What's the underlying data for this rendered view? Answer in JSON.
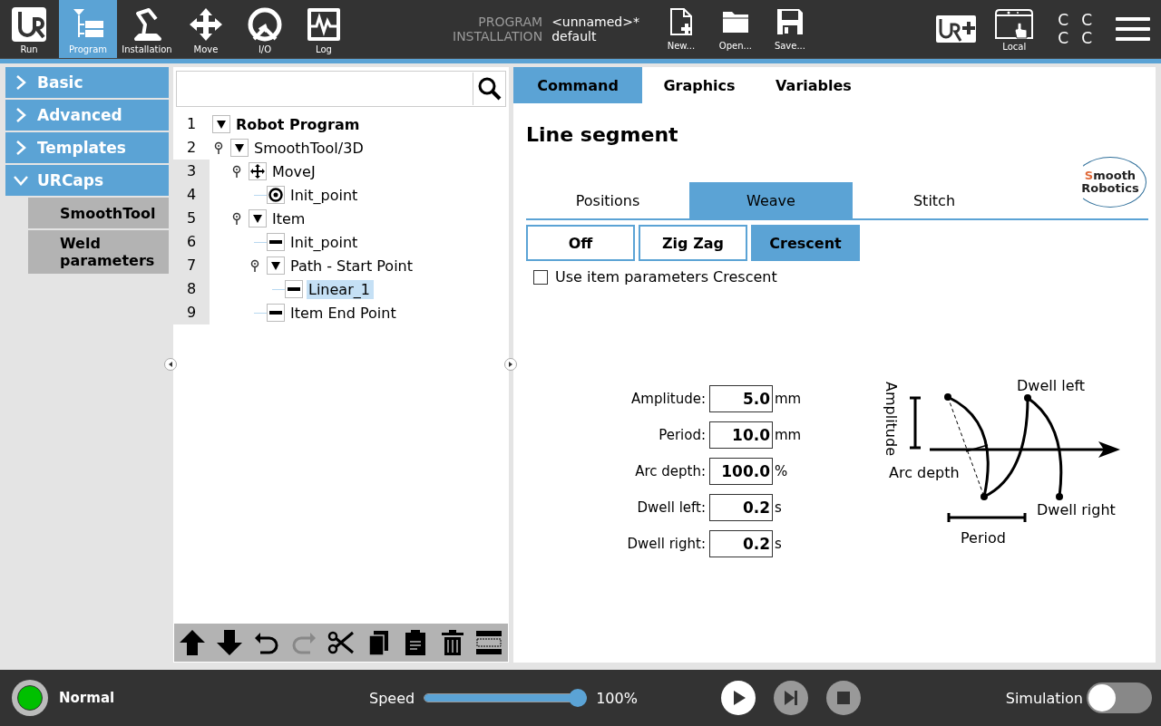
{
  "header": {
    "nav": [
      {
        "label": "Run",
        "selected": false
      },
      {
        "label": "Program",
        "selected": true
      },
      {
        "label": "Installation",
        "selected": false
      },
      {
        "label": "Move",
        "selected": false
      },
      {
        "label": "I/O",
        "selected": false
      },
      {
        "label": "Log",
        "selected": false
      }
    ],
    "program_info": [
      {
        "label": "PROGRAM",
        "value": "<unnamed>*"
      },
      {
        "label": "INSTALLATION",
        "value": "default"
      }
    ],
    "file_buttons": [
      "New...",
      "Open...",
      "Save..."
    ],
    "local_label": "Local",
    "corner_letters": [
      "C",
      "C",
      "C",
      "C"
    ]
  },
  "sidebar": [
    {
      "label": "Basic",
      "expanded": false
    },
    {
      "label": "Advanced",
      "expanded": false
    },
    {
      "label": "Templates",
      "expanded": false
    },
    {
      "label": "URCaps",
      "expanded": true,
      "children": [
        {
          "label": "SmoothTool"
        },
        {
          "label": "Weld parameters"
        }
      ]
    }
  ],
  "tree": {
    "nodes": [
      {
        "line": "1",
        "label": "Robot Program",
        "kind": "folder",
        "expanded": true,
        "selected": false,
        "shaded": false,
        "children": [
          {
            "line": "2",
            "label": "SmoothTool/3D",
            "kind": "folder",
            "expanded": true,
            "selected": false,
            "shaded": false,
            "children": [
              {
                "line": "3",
                "label": "MoveJ",
                "kind": "move",
                "selected": false,
                "shaded": true,
                "children": [
                  {
                    "line": "4",
                    "label": "Init_point",
                    "kind": "waypoint",
                    "selected": false,
                    "shaded": true
                  }
                ]
              },
              {
                "line": "5",
                "label": "Item",
                "kind": "folder",
                "expanded": true,
                "selected": false,
                "shaded": true,
                "children": [
                  {
                    "line": "6",
                    "label": "Init_point",
                    "kind": "line",
                    "selected": false,
                    "shaded": true
                  },
                  {
                    "line": "7",
                    "label": "Path - Start Point",
                    "kind": "folder",
                    "expanded": true,
                    "selected": false,
                    "shaded": true,
                    "children": [
                      {
                        "line": "8",
                        "label": "Linear_1",
                        "kind": "line",
                        "selected": true,
                        "shaded": true
                      }
                    ]
                  },
                  {
                    "line": "9",
                    "label": "Item End Point",
                    "kind": "line",
                    "selected": false,
                    "shaded": true
                  }
                ]
              }
            ]
          }
        ]
      }
    ],
    "toolbar": [
      {
        "disabled": false
      },
      {
        "disabled": false
      },
      {
        "disabled": false
      },
      {
        "disabled": true
      },
      {
        "disabled": false
      },
      {
        "disabled": false
      },
      {
        "disabled": false
      },
      {
        "disabled": false
      },
      {
        "disabled": false
      }
    ]
  },
  "panel": {
    "tabs": [
      {
        "label": "Command",
        "selected": true
      },
      {
        "label": "Graphics",
        "selected": false
      },
      {
        "label": "Variables",
        "selected": false
      }
    ],
    "title": "Line segment",
    "logo": {
      "accent": "S",
      "rest": "mooth",
      "line_2": "Robotics"
    },
    "subtabs": [
      {
        "label": "Positions",
        "selected": false
      },
      {
        "label": "Weave",
        "selected": true
      },
      {
        "label": "Stitch",
        "selected": false
      }
    ],
    "modes": [
      {
        "label": "Off",
        "selected": false
      },
      {
        "label": "Zig Zag",
        "selected": false
      },
      {
        "label": "Crescent",
        "selected": true
      }
    ],
    "checkbox": {
      "label": "Use item parameters Crescent",
      "checked": false
    },
    "params": [
      {
        "label": "Amplitude:",
        "value": "5.0",
        "unit": "mm"
      },
      {
        "label": "Period:",
        "value": "10.0",
        "unit": "mm"
      },
      {
        "label": "Arc depth:",
        "value": "100.0",
        "unit": "%"
      },
      {
        "label": "Dwell left:",
        "value": "0.2",
        "unit": "s"
      },
      {
        "label": "Dwell right:",
        "value": "0.2",
        "unit": "s"
      }
    ],
    "diagram": {
      "amplitude": "Amplitude",
      "dwell_left": "Dwell left",
      "arc_depth": "Arc depth",
      "dwell_right": "Dwell right",
      "period": "Period"
    }
  },
  "footer": {
    "status": {
      "label": "Normal",
      "color": "#00c000"
    },
    "speed": {
      "label": "Speed",
      "level": 1.0,
      "reading": "100%"
    },
    "controls": [
      {
        "disabled": false
      },
      {
        "disabled": true
      },
      {
        "disabled": true
      }
    ],
    "simulation": {
      "label": "Simulation",
      "on": false
    }
  }
}
